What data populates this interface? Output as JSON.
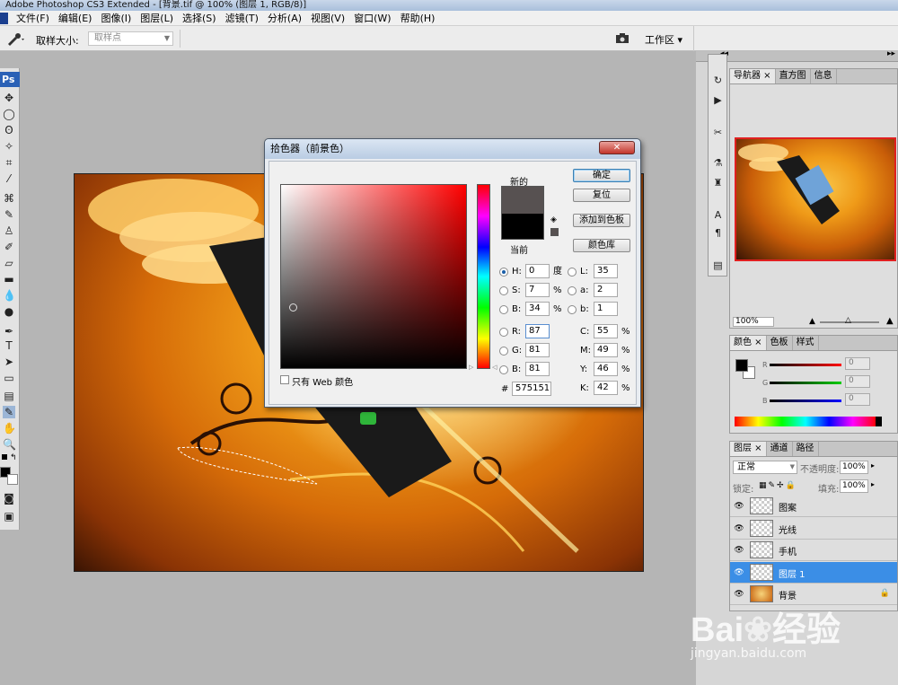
{
  "window": {
    "title": "Adobe Photoshop CS3 Extended - [背景.tif @ 100% (图层 1, RGB/8)]"
  },
  "menu": [
    "文件(F)",
    "编辑(E)",
    "图像(I)",
    "图层(L)",
    "选择(S)",
    "滤镜(T)",
    "分析(A)",
    "视图(V)",
    "窗口(W)",
    "帮助(H)"
  ],
  "options": {
    "sample_label": "取样大小:",
    "sample_value": "取样点",
    "workspace": "工作区 ▾"
  },
  "toolbox": {
    "ps_logo": "Ps"
  },
  "dialog": {
    "title": "拾色器（前景色）",
    "new_label": "新的",
    "current_label": "当前",
    "buttons": {
      "ok": "确定",
      "reset": "复位",
      "add_swatch": "添加到色板",
      "libraries": "颜色库"
    },
    "hsb": {
      "H_label": "H:",
      "H": "0",
      "H_unit": "度",
      "S_label": "S:",
      "S": "7",
      "S_unit": "%",
      "B_label": "B:",
      "B": "34",
      "B_unit": "%"
    },
    "rgb": {
      "R_label": "R:",
      "R": "87",
      "G_label": "G:",
      "G": "81",
      "B_label": "B:",
      "B": "81"
    },
    "lab": {
      "L_label": "L:",
      "L": "35",
      "a_label": "a:",
      "a": "2",
      "b_label": "b:",
      "b": "1"
    },
    "cmyk": {
      "C_label": "C:",
      "C": "55",
      "M_label": "M:",
      "M": "49",
      "Y_label": "Y:",
      "Y": "46",
      "K_label": "K:",
      "K": "42",
      "unit": "%"
    },
    "hex_label": "#",
    "hex": "575151",
    "web_only": "只有 Web 颜色",
    "new_color": "#575151",
    "current_color": "#000000"
  },
  "navigator": {
    "tabs": [
      "导航器",
      "直方图",
      "信息"
    ],
    "zoom": "100%"
  },
  "color_panel": {
    "tabs": [
      "颜色",
      "色板",
      "样式"
    ],
    "R": "0",
    "G": "0",
    "B": "0"
  },
  "layers_panel": {
    "tabs": [
      "图层",
      "通道",
      "路径"
    ],
    "blend": "正常",
    "opacity_label": "不透明度:",
    "opacity": "100%",
    "lock_label": "锁定:",
    "fill_label": "填充:",
    "fill": "100%",
    "layers": [
      {
        "name": "图案",
        "selected": false,
        "lock": ""
      },
      {
        "name": "光线",
        "selected": false,
        "lock": ""
      },
      {
        "name": "手机",
        "selected": false,
        "lock": ""
      },
      {
        "name": "图层 1",
        "selected": true,
        "lock": ""
      },
      {
        "name": "背景",
        "selected": false,
        "lock": "🔒"
      }
    ]
  },
  "watermark": {
    "brand": "Bai",
    "brand2": "经验",
    "url": "jingyan.baidu.com"
  }
}
